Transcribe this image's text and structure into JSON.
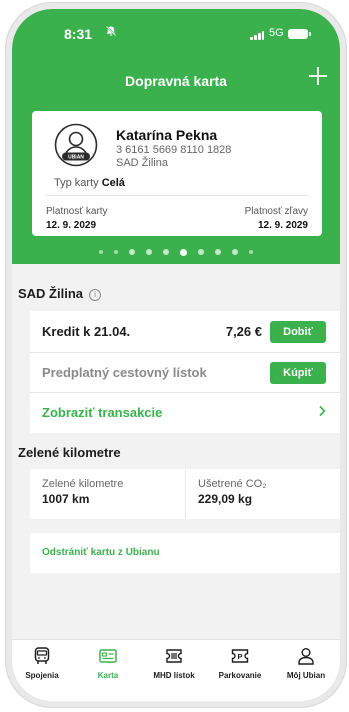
{
  "status_bar": {
    "time": "8:31",
    "network": "5G"
  },
  "header": {
    "title": "Dopravná karta",
    "add_icon": "plus-icon"
  },
  "card": {
    "holder_name": "Katarína Pekna",
    "card_number": "3 6161 5669 8110 1828",
    "issuer": "SAD Žilina",
    "avatar_badge": "UBIAN",
    "type_label": "Typ karty",
    "type_value": "Celá",
    "card_validity_label": "Platnosť karty",
    "card_validity_date": "12. 9. 2029",
    "discount_validity_label": "Platnosť zľavy",
    "discount_validity_date": "12. 9. 2029"
  },
  "carousel": {
    "count": 10,
    "active_index": 5
  },
  "operator": {
    "title": "SAD Žilina"
  },
  "credit": {
    "label": "Kredit k 21.04.",
    "amount": "7,26 €",
    "button": "Dobiť"
  },
  "season_ticket": {
    "label": "Predplatný cestovný lístok",
    "button": "Kúpiť"
  },
  "transactions": {
    "label": "Zobraziť transakcie"
  },
  "green_km": {
    "title": "Zelené kilometre",
    "km_label": "Zelené kilometre",
    "km_value": "1007 km",
    "co2_label": "Ušetrené CO₂",
    "co2_value": "229,09 kg"
  },
  "remove_card": {
    "label": "Odstrániť kartu z Ubianu"
  },
  "bottom_nav": [
    {
      "label": "Spojenia",
      "icon": "bus-icon"
    },
    {
      "label": "Karta",
      "icon": "card-icon",
      "active": true
    },
    {
      "label": "MHD lístok",
      "icon": "ticket-icon"
    },
    {
      "label": "Parkovanie",
      "icon": "parking-icon"
    },
    {
      "label": "Môj Ubian",
      "icon": "user-icon"
    }
  ],
  "colors": {
    "brand": "#3bb14e",
    "background": "#f2f2f2"
  }
}
